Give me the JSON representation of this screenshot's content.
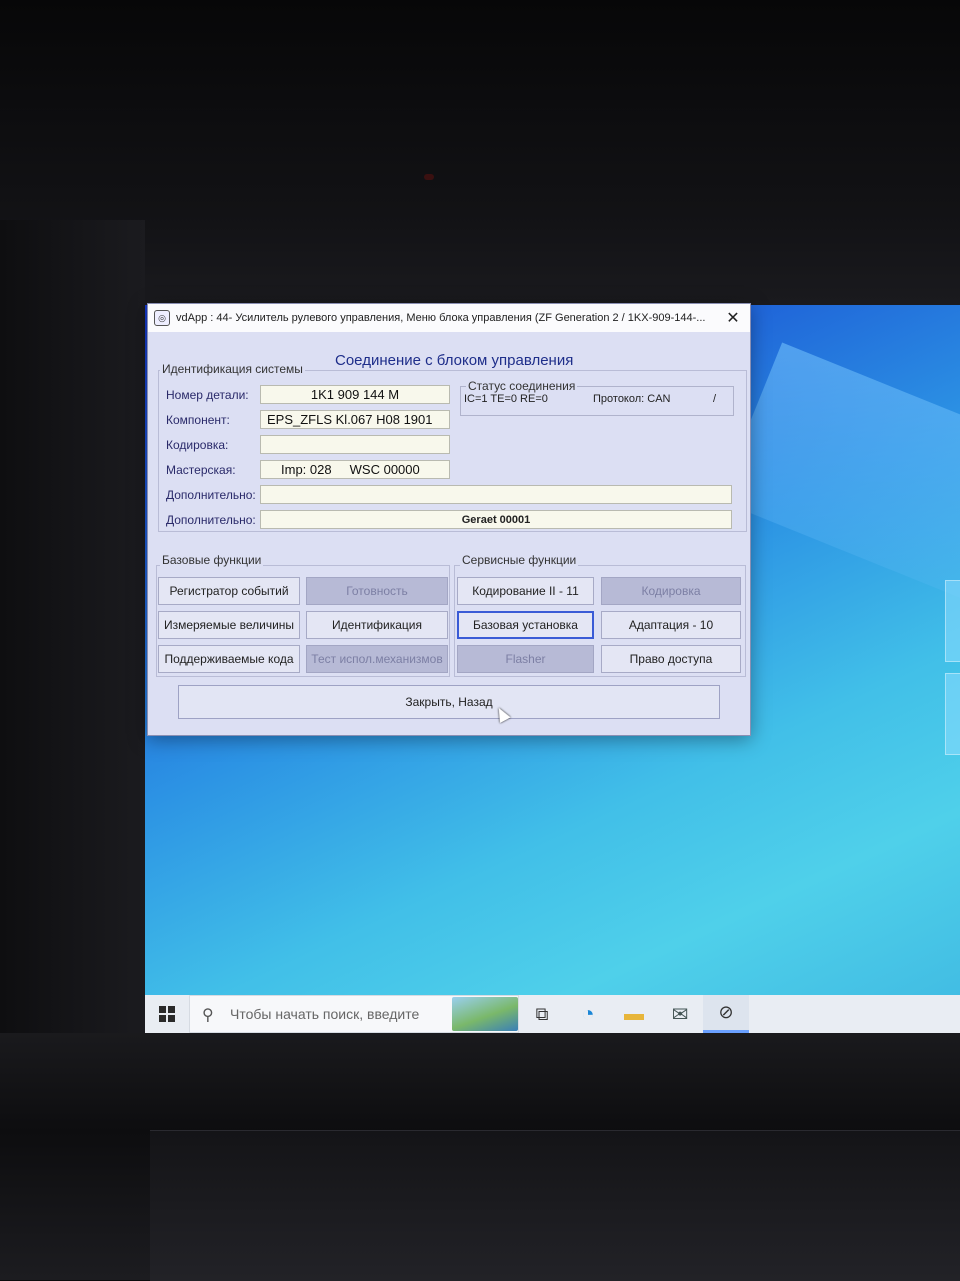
{
  "window": {
    "title": "vdApp : 44- Усилитель рулевого управления,  Меню блока управления (ZF Generation 2 / 1KX-909-144-...",
    "close_glyph": "✕",
    "heading": "Соединение с блоком управления"
  },
  "identification": {
    "group_label": "Идентификация системы",
    "fields": [
      {
        "label": "Номер детали:",
        "value": "1K1 909 144 M"
      },
      {
        "label": "Компонент:",
        "value": "EPS_ZFLS Kl.067 H08 1901"
      },
      {
        "label": "Кодировка:",
        "value": ""
      },
      {
        "label": "Мастерская:",
        "value": "Imp: 028     WSC 00000"
      },
      {
        "label": "Дополнительно:",
        "value": ""
      },
      {
        "label": "Дополнительно:",
        "value": "Geraet 00001"
      }
    ]
  },
  "connection_status": {
    "label": "Статус соединения",
    "counters": "IC=1  TE=0   RE=0",
    "protocol": "Протокол: CAN",
    "slash": "/"
  },
  "basic_functions": {
    "label": "Базовые функции",
    "buttons": [
      {
        "label": "Регистратор событий",
        "enabled": true
      },
      {
        "label": "Готовность",
        "enabled": false
      },
      {
        "label": "Измеряемые величины",
        "enabled": true
      },
      {
        "label": "Идентификация",
        "enabled": true
      },
      {
        "label": "Поддерживаемые кода",
        "enabled": true
      },
      {
        "label": "Тест испол.механизмов",
        "enabled": false
      }
    ]
  },
  "service_functions": {
    "label": "Сервисные функции",
    "buttons": [
      {
        "label": "Кодирование II - 11",
        "enabled": true
      },
      {
        "label": "Кодировка",
        "enabled": false
      },
      {
        "label": "Базовая установка",
        "enabled": true
      },
      {
        "label": "Адаптация - 10",
        "enabled": true
      },
      {
        "label": "Flasher",
        "enabled": false
      },
      {
        "label": "Право доступа",
        "enabled": true
      }
    ]
  },
  "close_button": {
    "label": "Закрыть, Назад"
  },
  "taskbar": {
    "search_placeholder": "Чтобы начать поиск, введите",
    "icons": [
      "windows-start-icon",
      "search-icon",
      "task-view-icon",
      "edge-icon",
      "file-explorer-icon",
      "mail-icon",
      "vdapp-icon"
    ]
  },
  "colors": {
    "window_bg": "#dcdff3",
    "heading": "#1e2e8a",
    "disabled_button": "#b7bad6",
    "desktop_blue": "#2c93e4"
  }
}
